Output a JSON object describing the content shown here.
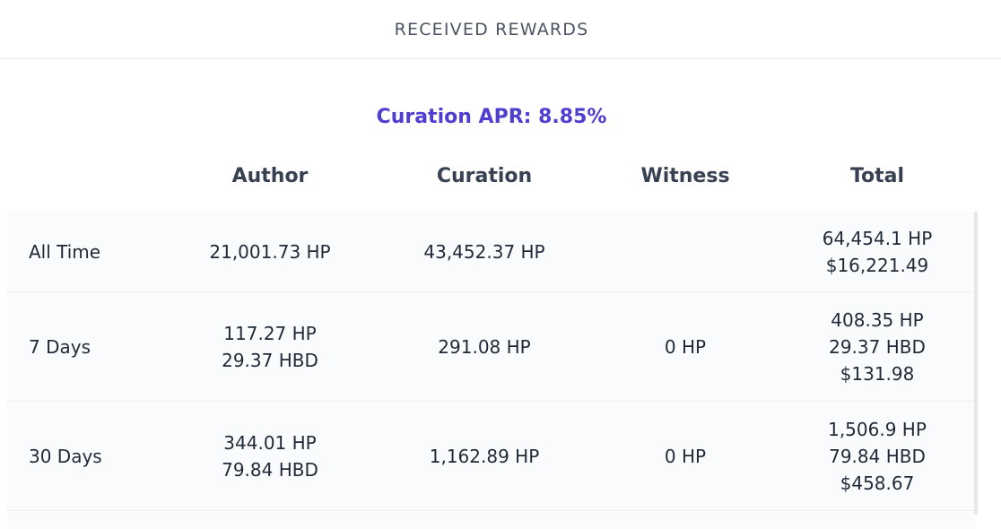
{
  "header": {
    "title": "RECEIVED REWARDS"
  },
  "apr": {
    "label": "Curation APR:",
    "value": "8.85%"
  },
  "columns": {
    "author": "Author",
    "curation": "Curation",
    "witness": "Witness",
    "total": "Total"
  },
  "rows": [
    {
      "label": "All Time",
      "author": [
        "21,001.73 HP"
      ],
      "curation": [
        "43,452.37 HP"
      ],
      "witness": [],
      "total": [
        "64,454.1 HP",
        "$16,221.49"
      ]
    },
    {
      "label": "7 Days",
      "author": [
        "117.27 HP",
        "29.37 HBD"
      ],
      "curation": [
        "291.08 HP"
      ],
      "witness": [
        "0 HP"
      ],
      "total": [
        "408.35 HP",
        "29.37 HBD",
        "$131.98"
      ]
    },
    {
      "label": "30 Days",
      "author": [
        "344.01 HP",
        "79.84 HBD"
      ],
      "curation": [
        "1,162.89 HP"
      ],
      "witness": [
        "0 HP"
      ],
      "total": [
        "1,506.9 HP",
        "79.84 HBD",
        "$458.67"
      ]
    }
  ]
}
